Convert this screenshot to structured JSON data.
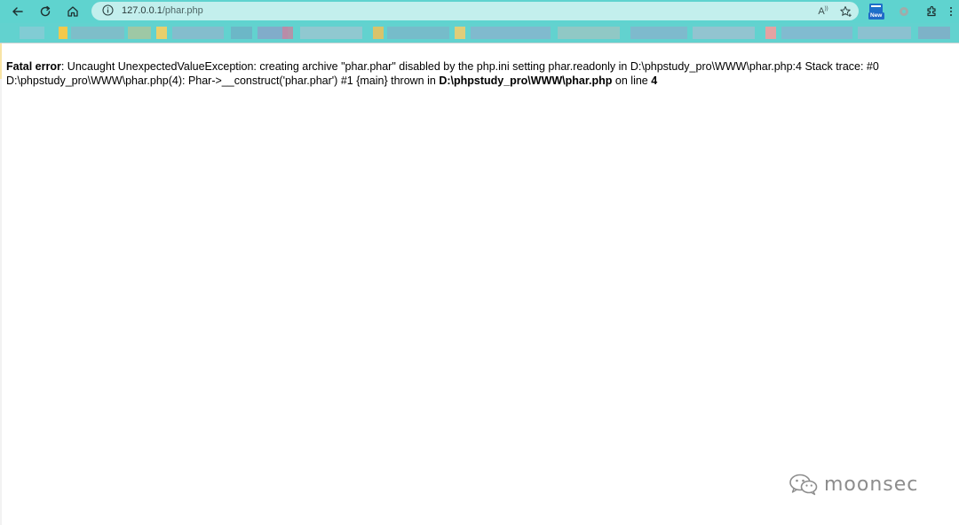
{
  "browser": {
    "nav": {
      "back_icon": "arrow-left-icon",
      "reload_icon": "reload-icon",
      "home_icon": "home-icon"
    },
    "address_bar": {
      "info_icon": "info-icon",
      "host": "127.0.0.1",
      "path": "/phar.php",
      "read_aloud_label": "A",
      "favorite_icon": "star-plus-icon"
    },
    "extensions": {
      "new_badge_label": "New",
      "settings_icon": "gear-icon",
      "extensions_icon": "puzzle-icon"
    },
    "colors": {
      "toolbar": "#5fd3cf",
      "address_bar": "#c3efed",
      "bookmarks_bar": "#62d2cf"
    }
  },
  "page": {
    "error_label": "Fatal error",
    "message_1": ": Uncaught UnexpectedValueException: creating archive \"phar.phar\" disabled by the php.ini setting phar.readonly in D:\\phpstudy_pro\\WWW\\phar.php:4 Stack trace: #0 D:\\phpstudy_pro\\WWW\\phar.php(4): Phar->__construct('phar.phar') #1 {main} thrown in ",
    "file_path": "D:\\phpstudy_pro\\WWW\\phar.php",
    "message_2": " on line ",
    "line_number": "4"
  },
  "watermark": {
    "text": "moonsec",
    "icon": "wechat-icon"
  }
}
